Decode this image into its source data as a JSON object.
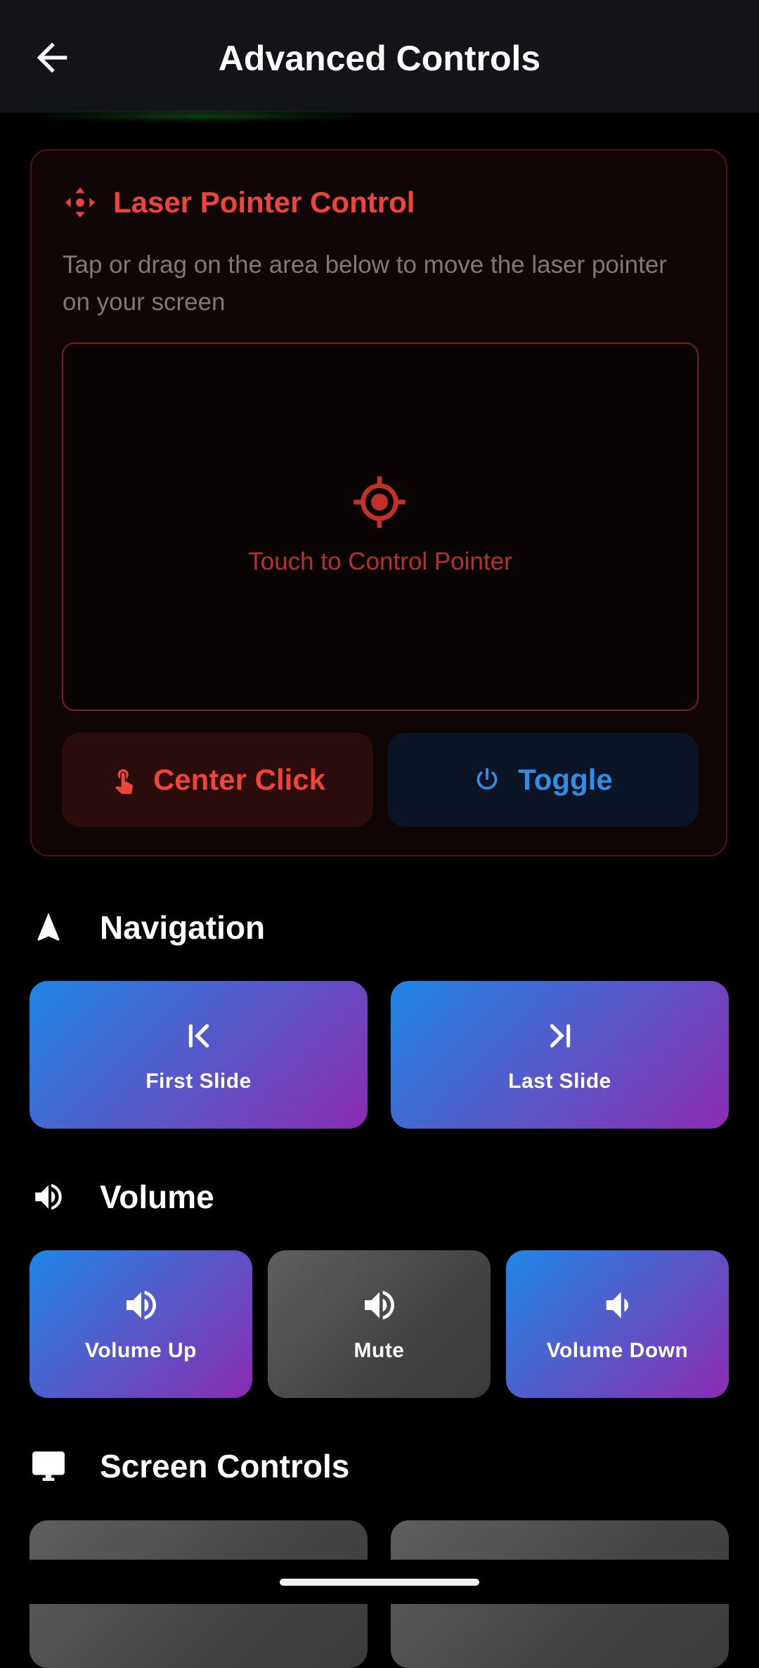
{
  "appbar": {
    "title": "Advanced Controls",
    "back_icon": "arrow-left-icon"
  },
  "laser": {
    "title": "Laser Pointer Control",
    "description": "Tap or drag on the area below to move the laser pointer on your screen",
    "pad_text": "Touch to Control Pointer",
    "center_click": "Center Click",
    "toggle": "Toggle",
    "accent": "#f0443a"
  },
  "navigation": {
    "heading": "Navigation",
    "first": "First Slide",
    "last": "Last Slide"
  },
  "volume": {
    "heading": "Volume",
    "up": "Volume Up",
    "mute": "Mute",
    "down": "Volume Down"
  },
  "screen": {
    "heading": "Screen Controls"
  },
  "colors": {
    "gradient_start": "#1f86e6",
    "gradient_end": "#8b2bb4",
    "toggle_blue": "#2f8fe6"
  }
}
